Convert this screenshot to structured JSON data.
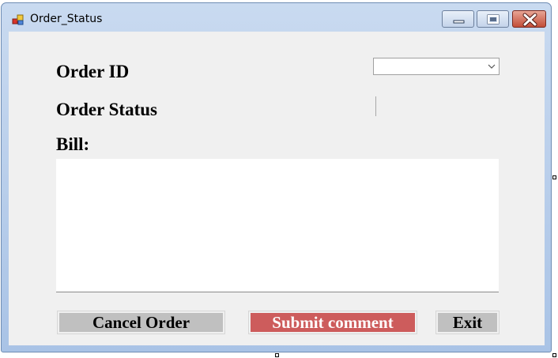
{
  "window": {
    "title": "Order_Status"
  },
  "form": {
    "order_id_label": "Order ID",
    "order_id_value": "",
    "order_status_label": "Order Status",
    "order_status_value": "",
    "bill_label": "Bill:",
    "bill_text": ""
  },
  "buttons": {
    "cancel_label": "Cancel Order",
    "submit_label": "Submit comment",
    "exit_label": "Exit"
  },
  "colors": {
    "submit_button": "#cd5c5c",
    "gray_button": "#c0c0c0",
    "form_background": "#f0f0f0"
  },
  "icons": {
    "app": "app-icon",
    "minimize": "minimize-icon",
    "maximize": "maximize-icon",
    "close": "close-icon",
    "dropdown": "chevron-down-icon"
  }
}
